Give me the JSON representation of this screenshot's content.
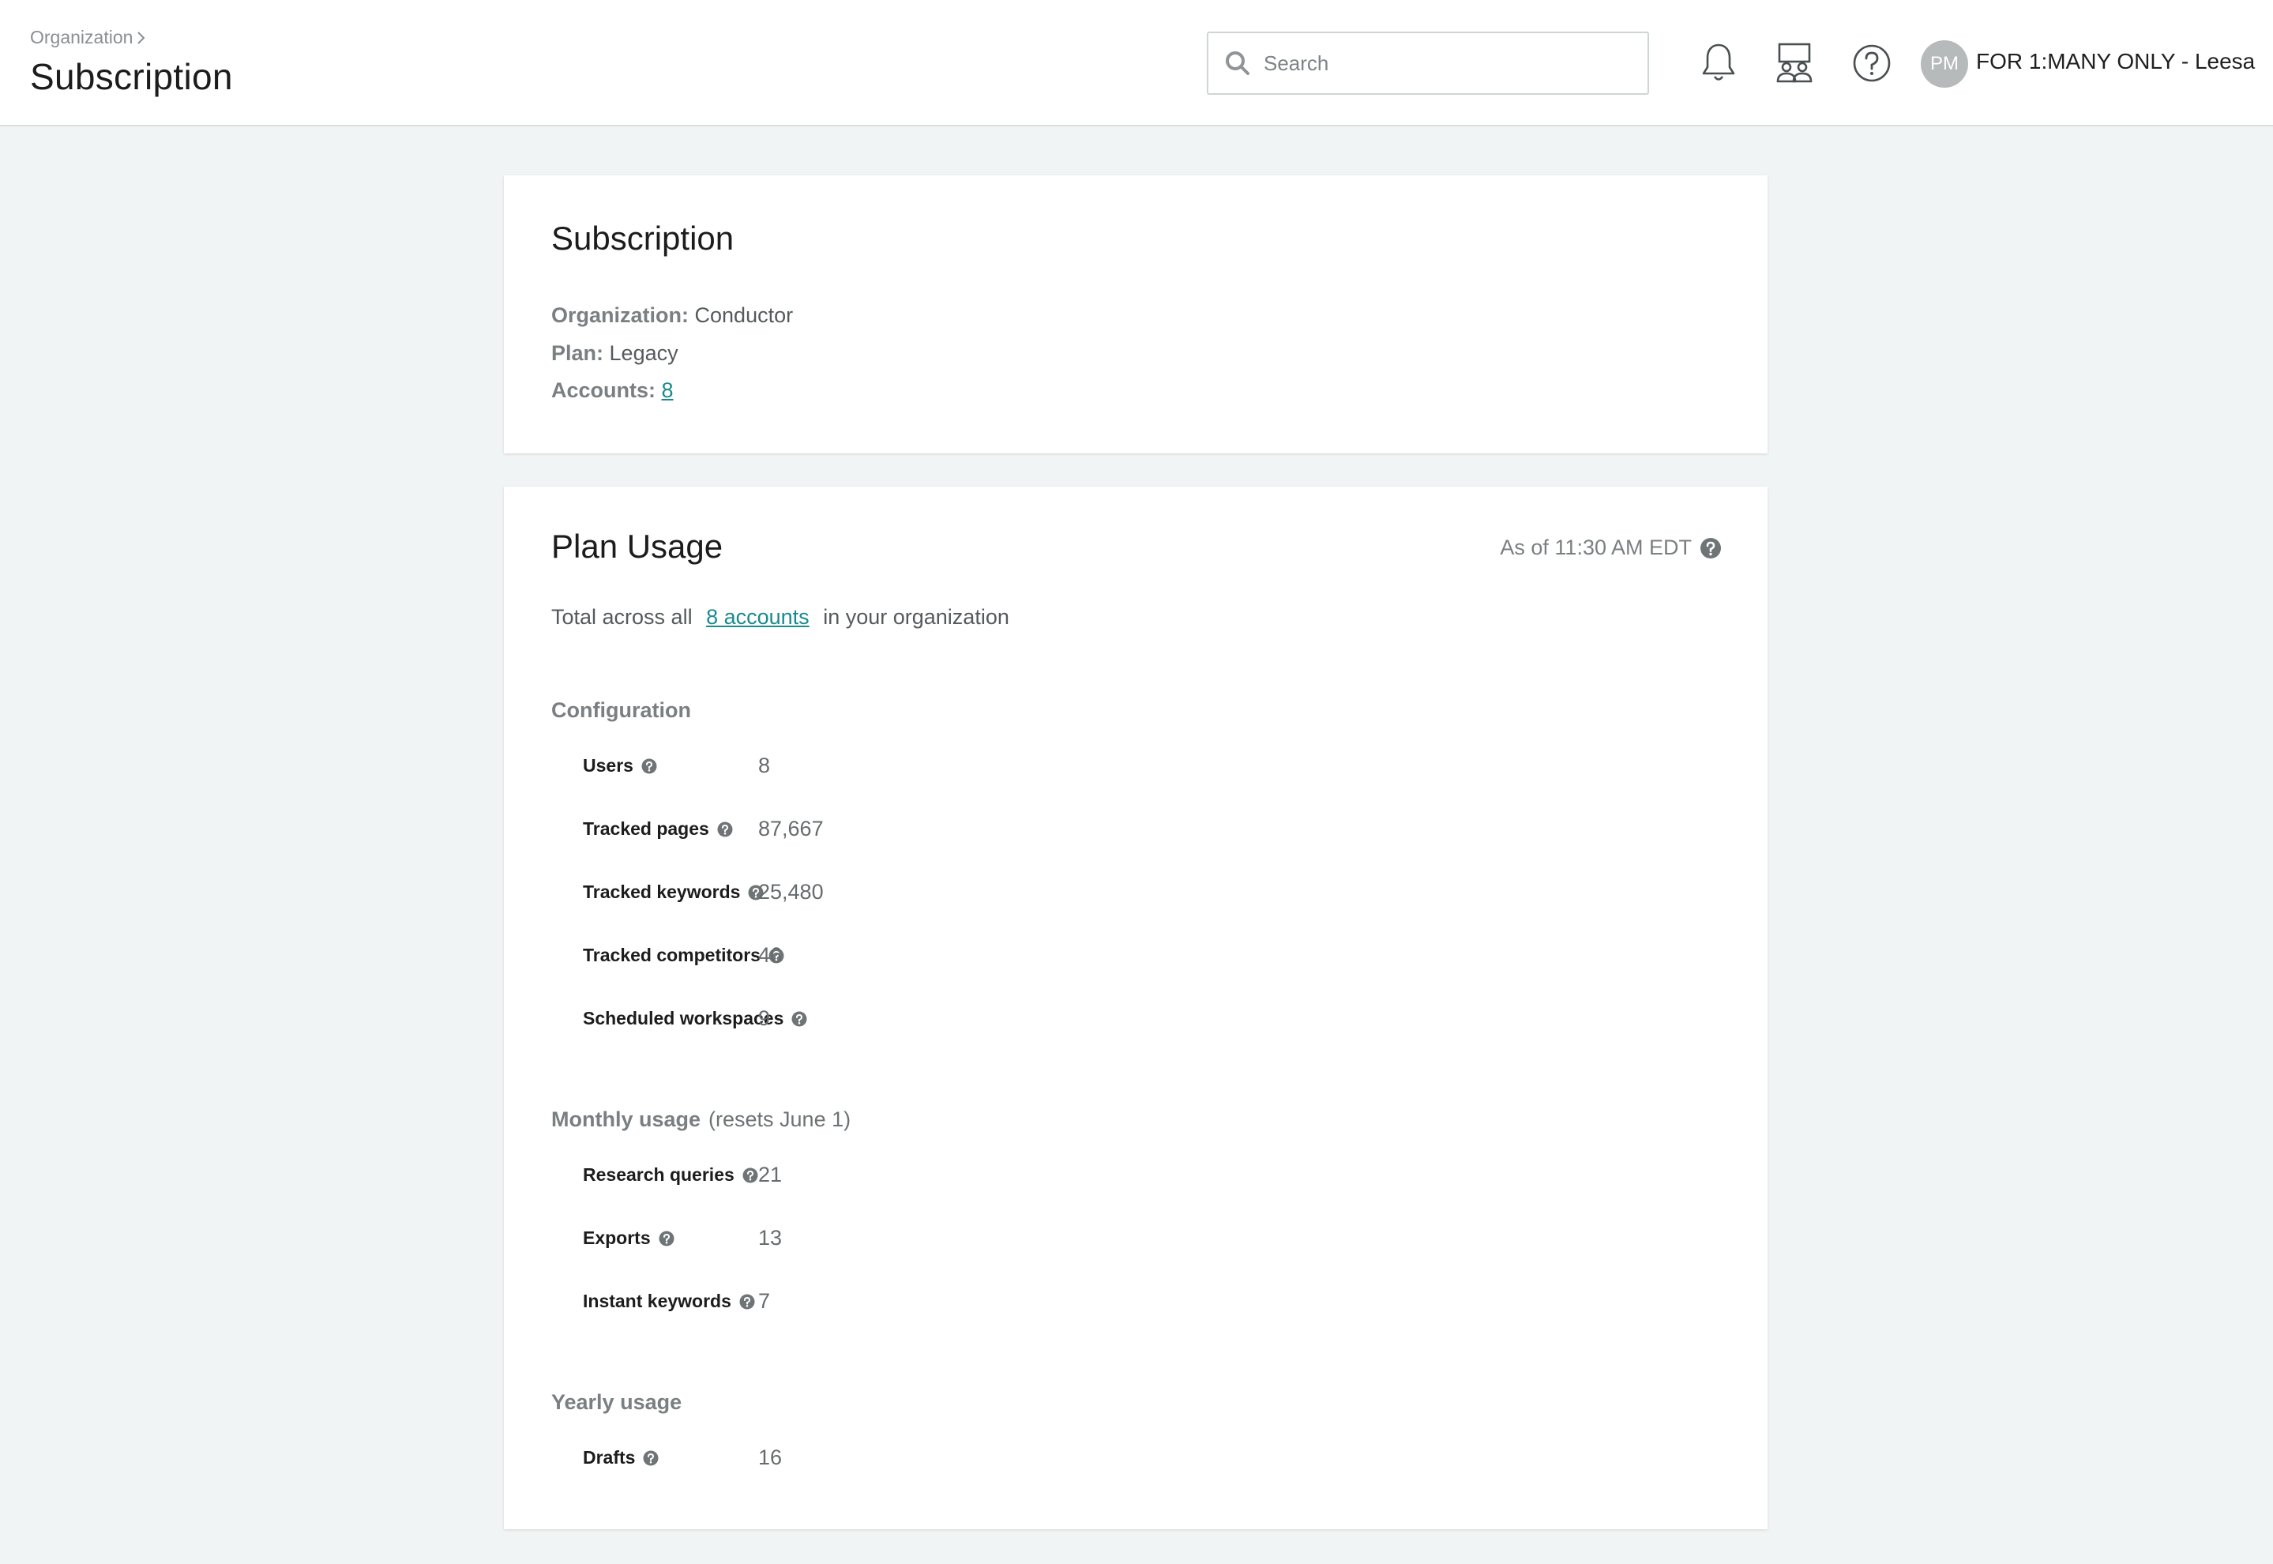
{
  "header": {
    "breadcrumb": "Organization",
    "title": "Subscription",
    "search_placeholder": "Search",
    "user_initials": "PM",
    "user_name": "FOR 1:MANY ONLY - Leesa",
    "icons": [
      "bell-icon",
      "team-icon",
      "help-icon"
    ]
  },
  "subscription": {
    "title": "Subscription",
    "organization_label": "Organization:",
    "organization_value": "Conductor",
    "plan_label": "Plan:",
    "plan_value": "Legacy",
    "accounts_label": "Accounts:",
    "accounts_value": "8"
  },
  "plan_usage": {
    "title": "Plan Usage",
    "as_of": "As of 11:30 AM EDT",
    "total_prefix": "Total across all",
    "total_link": "8 accounts",
    "total_suffix": "in your organization",
    "configuration": {
      "title": "Configuration",
      "rows": [
        {
          "label": "Users",
          "value": "8"
        },
        {
          "label": "Tracked pages",
          "value": "87,667"
        },
        {
          "label": "Tracked keywords",
          "value": "25,480"
        },
        {
          "label": "Tracked competitors",
          "value": "46"
        },
        {
          "label": "Scheduled workspaces",
          "value": "9"
        }
      ]
    },
    "monthly": {
      "title": "Monthly usage",
      "note": "(resets June 1)",
      "rows": [
        {
          "label": "Research queries",
          "value": "21"
        },
        {
          "label": "Exports",
          "value": "13"
        },
        {
          "label": "Instant keywords",
          "value": "7"
        }
      ]
    },
    "yearly": {
      "title": "Yearly usage",
      "rows": [
        {
          "label": "Drafts",
          "value": "16"
        }
      ]
    }
  },
  "colors": {
    "accent_link": "#1b8a8f",
    "page_bg": "#f1f4f4",
    "avatar_bg": "#b7babb"
  }
}
